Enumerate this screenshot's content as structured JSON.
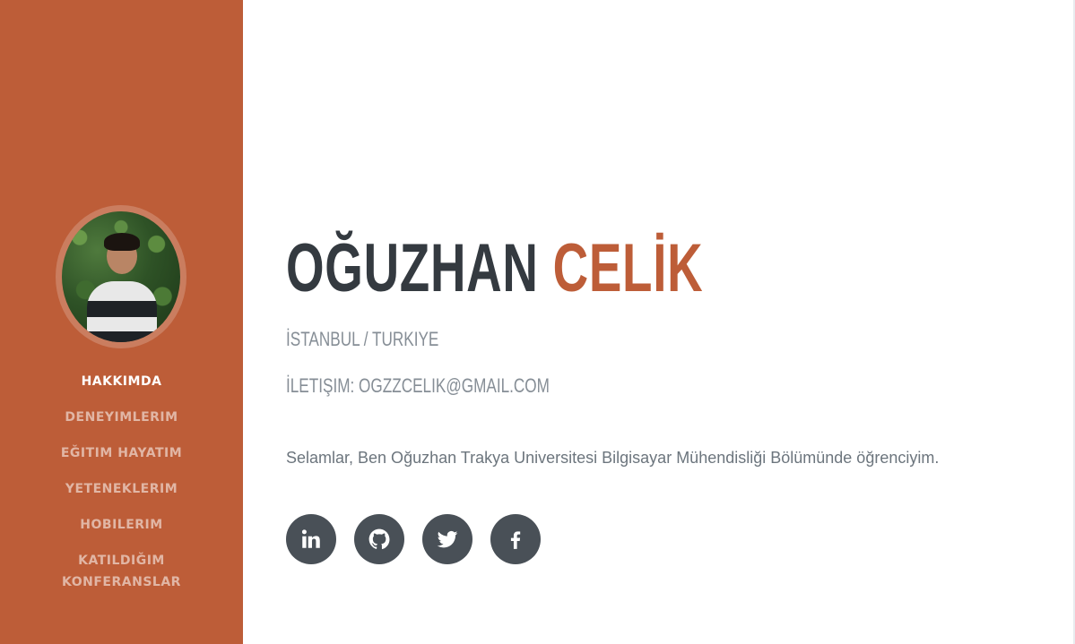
{
  "sidebar": {
    "bg_color": "#bd5d38",
    "avatar_alt": "profile photo",
    "nav": [
      {
        "label": "HAKKIMDA",
        "active": true
      },
      {
        "label": "DENEYIMLERIM",
        "active": false
      },
      {
        "label": "EĞITIM HAYATIM",
        "active": false
      },
      {
        "label": "YETENEKLERIM",
        "active": false
      },
      {
        "label": "HOBILERIM",
        "active": false
      },
      {
        "label_line1": "KATILDIĞIM",
        "label_line2": "KONFERANSLAR",
        "active": false
      }
    ]
  },
  "profile": {
    "first_name": "OĞUZHAN",
    "last_name": "CELİK",
    "location": "İSTANBUL / TURKIYE",
    "contact_label": "İLETIŞIM:",
    "email": "OGZZCELIK@GMAIL.COM",
    "bio": "Selamlar, Ben Oğuzhan Trakya Universitesi Bilgisayar Mühendisliği Bölümünde öğrenciyim."
  },
  "social": [
    {
      "name": "linkedin",
      "icon": "linkedin-icon",
      "glyph": "in"
    },
    {
      "name": "github",
      "icon": "github-icon"
    },
    {
      "name": "twitter",
      "icon": "twitter-icon"
    },
    {
      "name": "facebook",
      "icon": "facebook-icon",
      "glyph": "f"
    }
  ],
  "colors": {
    "accent": "#bd5d38",
    "heading": "#343a40",
    "muted": "#868e96",
    "social_bg": "#495057"
  }
}
